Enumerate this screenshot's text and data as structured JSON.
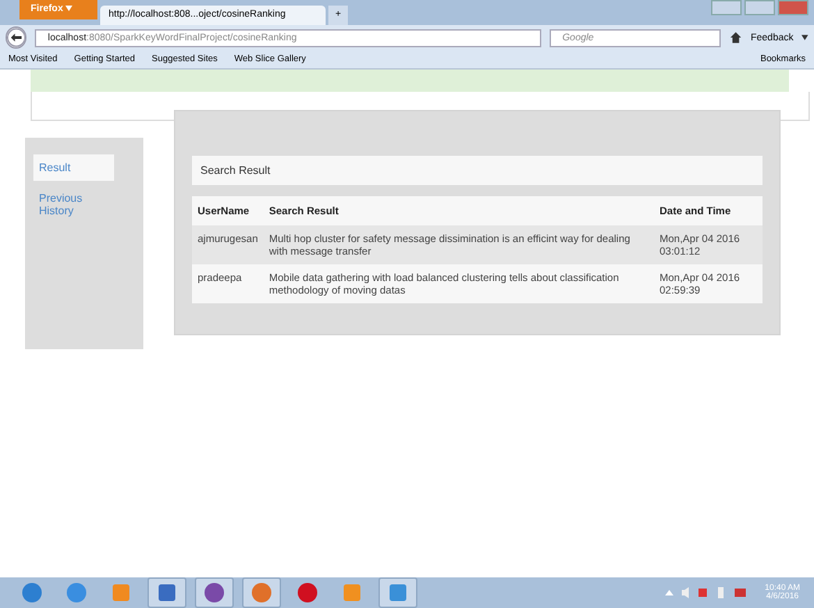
{
  "browser": {
    "menu_button": "Firefox",
    "tabs": [
      {
        "label": "http://localhost:808...oject/cosineRanking",
        "selected": true
      }
    ],
    "new_tab": "+",
    "address_host": "localhost",
    "address_rest": ":8080/SparkKeyWordFinalProject/cosineRanking",
    "search_placeholder": "Google",
    "feedback": "Feedback",
    "bookmarks": [
      {
        "label": "Most Visited"
      },
      {
        "label": "Getting Started"
      },
      {
        "label": "Suggested Sites"
      },
      {
        "label": "Web Slice Gallery"
      }
    ],
    "bookmarks_button": "Bookmarks"
  },
  "sidebar": {
    "items": [
      {
        "label": "Result",
        "selected": true
      },
      {
        "label": "Previous History",
        "selected": false
      }
    ]
  },
  "panel": {
    "title": "Search Result",
    "table": {
      "columns": [
        "UserName",
        "Search Result",
        "Date and Time"
      ],
      "rows": [
        {
          "cells": [
            "ajmurugesan",
            "Multi hop cluster for safety message dissimination is an efficint way for dealing with message transfer",
            "Mon,Apr 04 2016 03:01:12"
          ]
        },
        {
          "cells": [
            "pradeepa",
            "Mobile data gathering with load balanced clustering tells about classification methodology of moving datas",
            "Mon,Apr 04 2016 02:59:39"
          ]
        }
      ]
    }
  },
  "taskbar": {
    "apps": [
      {
        "kind": "start",
        "pinned": false
      },
      {
        "kind": "ie",
        "pinned": false
      },
      {
        "kind": "media",
        "pinned": false
      },
      {
        "kind": "word",
        "pinned": true
      },
      {
        "kind": "orb",
        "pinned": true
      },
      {
        "kind": "firefox",
        "pinned": true
      },
      {
        "kind": "opera",
        "pinned": false
      },
      {
        "kind": "uc",
        "pinned": false
      },
      {
        "kind": "bolt",
        "pinned": true
      }
    ],
    "time": "10:40 AM",
    "date": "4/6/2016"
  }
}
